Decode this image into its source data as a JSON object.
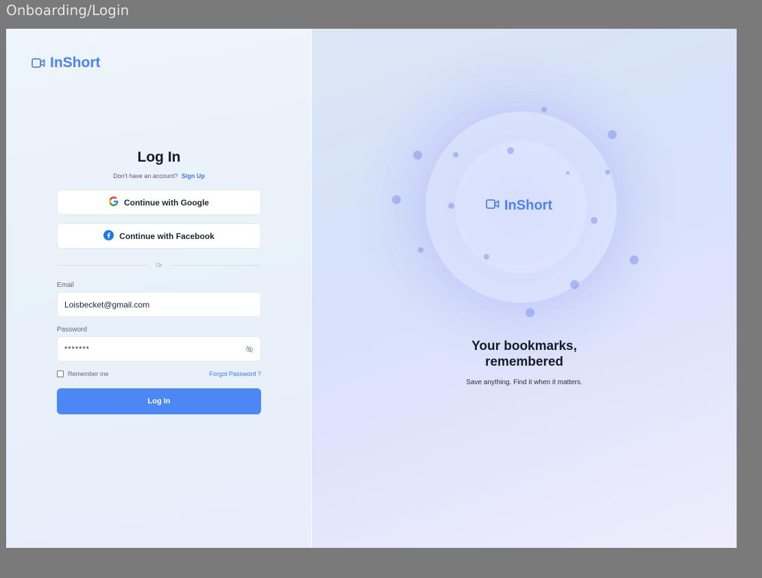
{
  "frame_title": "Onboarding/Login",
  "brand": {
    "name": "InShort",
    "icon": "video-camera-icon"
  },
  "login": {
    "title": "Log In",
    "no_account_text": "Don't have an account?",
    "signup_link": "Sign Up",
    "google_button": "Continue with Google",
    "facebook_button": "Continue with Facebook",
    "divider_text": "Or",
    "email_label": "Email",
    "email_value": "Loisbecket@gmail.com",
    "password_label": "Password",
    "password_value": "*******",
    "remember_label": "Remember me",
    "remember_checked": false,
    "forgot_link": "Forgot Password ?",
    "submit_button": "Log In"
  },
  "hero": {
    "brand_name": "InShort",
    "headline_line1": "Your bookmarks,",
    "headline_line2": "remembered",
    "subline": "Save anything. Find it when it matters."
  },
  "colors": {
    "accent": "#4c88f5",
    "brand_text": "#4a82f0",
    "link": "#3f7be8"
  }
}
